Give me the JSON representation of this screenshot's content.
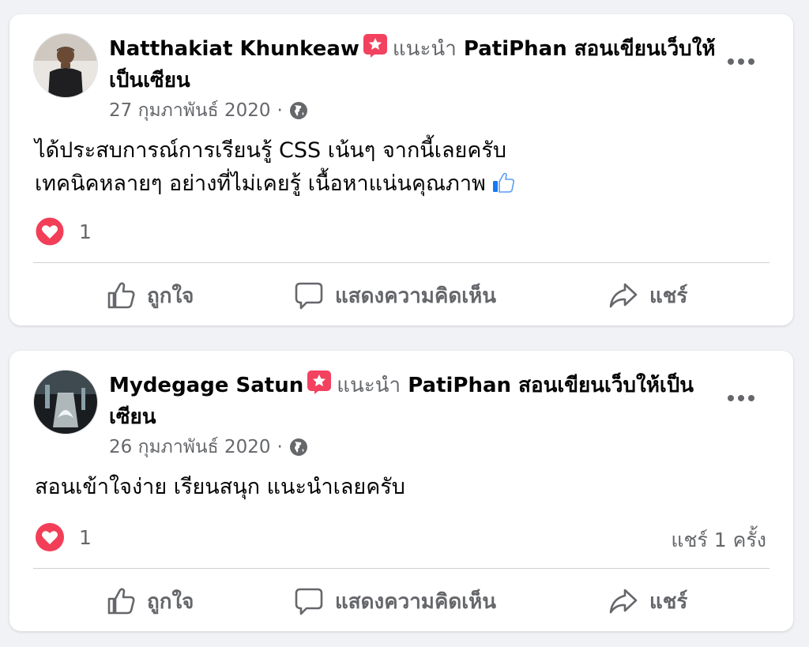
{
  "posts": [
    {
      "author": "Natthakiat Khunkeaw",
      "recommends": "แนะนำ",
      "page_name_line1": "PatiPhan สอนเขียนเว็บให้",
      "page_name_line2": "เป็นเซียน",
      "date": "27 กุมภาพันธ์ 2020",
      "body_lines": [
        "ได้ประสบการณ์การเรียนรู้ CSS เน้นๆ จากนี้เลยครับ",
        "เทคนิคหลายๆ อย่างที่ไม่เคยรู้ เนื้อหาแน่นคุณภาพ"
      ],
      "reaction_count": "1",
      "share_count_text": ""
    },
    {
      "author": "Mydegage Satun",
      "recommends": "แนะนำ",
      "page_name_line1": "PatiPhan สอนเขียนเว็บให้เป็น",
      "page_name_line2": "เซียน",
      "date": "26 กุมภาพันธ์ 2020",
      "body_lines": [
        "สอนเข้าใจง่าย เรียนสนุก แนะนำเลยครับ"
      ],
      "reaction_count": "1",
      "share_count_text": "แชร์ 1 ครั้ง"
    }
  ],
  "actions": {
    "like": "ถูกใจ",
    "comment": "แสดงความคิดเห็น",
    "share": "แชร์"
  },
  "colors": {
    "recommend_badge": "#f3425f",
    "heart": "#f33e58",
    "text_secondary": "#65676b",
    "background": "#f0f2f5"
  },
  "icons": [
    "recommend-star-icon",
    "globe-icon",
    "heart-reaction-icon",
    "like-icon",
    "comment-icon",
    "share-icon",
    "more-icon"
  ]
}
